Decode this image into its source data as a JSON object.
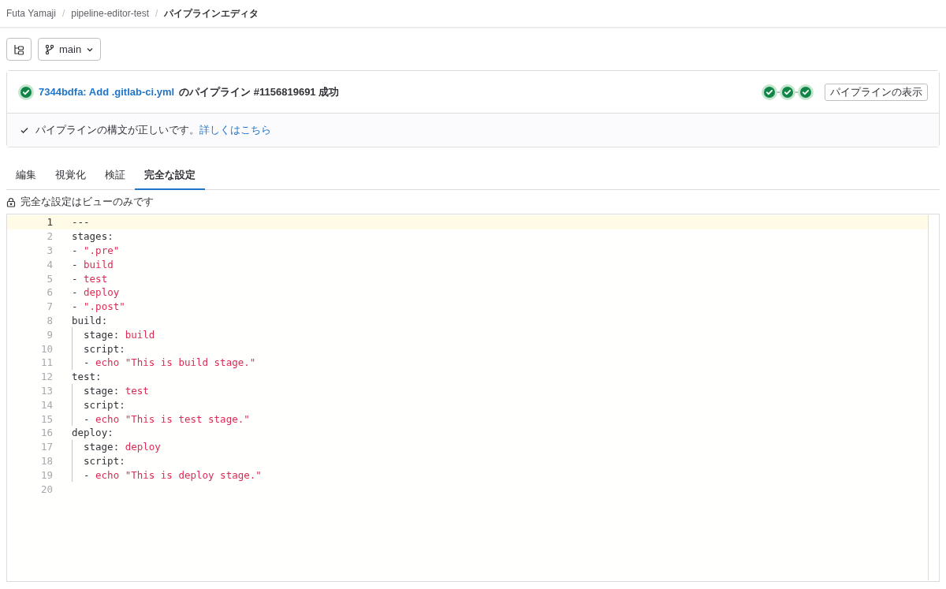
{
  "breadcrumb": [
    {
      "label": "Futa Yamaji",
      "current": false
    },
    {
      "separator": "/",
      "label": "pipeline-editor-test",
      "current": false
    },
    {
      "separator": "/",
      "label": "パイプラインエディタ",
      "current": true
    }
  ],
  "branch": {
    "label": "main"
  },
  "pipeline": {
    "passed": true,
    "link": "7344bdfa: Add .gitlab-ci.yml",
    "text": "のパイプライン #1156819691 成功",
    "stages": [
      {
        "passed": true
      },
      {
        "passed": true
      },
      {
        "passed": true
      }
    ],
    "view_button": "パイプラインの表示"
  },
  "validation": {
    "valid": true,
    "message": "パイプラインの構文が正しいです。",
    "link": "詳しくはこちら"
  },
  "tabs": [
    {
      "label": "編集",
      "selected": false
    },
    {
      "label": "視覚化",
      "selected": false
    },
    {
      "label": "検証",
      "selected": false
    },
    {
      "label": "完全な設定",
      "selected": true
    }
  ],
  "notice": "完全な設定はビューのみです",
  "code": [
    {
      "number": "1",
      "current": true,
      "indent": false,
      "key": "---"
    },
    {
      "number": "2",
      "current": false,
      "indent": false,
      "key": "stages:"
    },
    {
      "number": "3",
      "current": false,
      "indent": false,
      "key": "- ",
      "value": "\".pre\""
    },
    {
      "number": "4",
      "current": false,
      "indent": false,
      "key": "- ",
      "value": "build"
    },
    {
      "number": "5",
      "current": false,
      "indent": false,
      "key": "- ",
      "value": "test"
    },
    {
      "number": "6",
      "current": false,
      "indent": false,
      "key": "- ",
      "value": "deploy"
    },
    {
      "number": "7",
      "current": false,
      "indent": false,
      "key": "- ",
      "value": "\".post\""
    },
    {
      "number": "8",
      "current": false,
      "indent": false,
      "key": "build:"
    },
    {
      "number": "9",
      "current": false,
      "indent": true,
      "key": "stage: ",
      "value": "build"
    },
    {
      "number": "10",
      "current": false,
      "indent": true,
      "key": "script:"
    },
    {
      "number": "11",
      "current": false,
      "indent": true,
      "key": "- ",
      "value": "echo \"This is build stage.\""
    },
    {
      "number": "12",
      "current": false,
      "indent": false,
      "key": "test:"
    },
    {
      "number": "13",
      "current": false,
      "indent": true,
      "key": "stage: ",
      "value": "test"
    },
    {
      "number": "14",
      "current": false,
      "indent": true,
      "key": "script:"
    },
    {
      "number": "15",
      "current": false,
      "indent": true,
      "key": "- ",
      "value": "echo \"This is test stage.\""
    },
    {
      "number": "16",
      "current": false,
      "indent": false,
      "key": "deploy:"
    },
    {
      "number": "17",
      "current": false,
      "indent": true,
      "key": "stage: ",
      "value": "deploy"
    },
    {
      "number": "18",
      "current": false,
      "indent": true,
      "key": "script:"
    },
    {
      "number": "19",
      "current": false,
      "indent": true,
      "key": "- ",
      "value": "echo \"This is deploy stage.\""
    },
    {
      "number": "20",
      "current": false,
      "indent": false
    }
  ]
}
